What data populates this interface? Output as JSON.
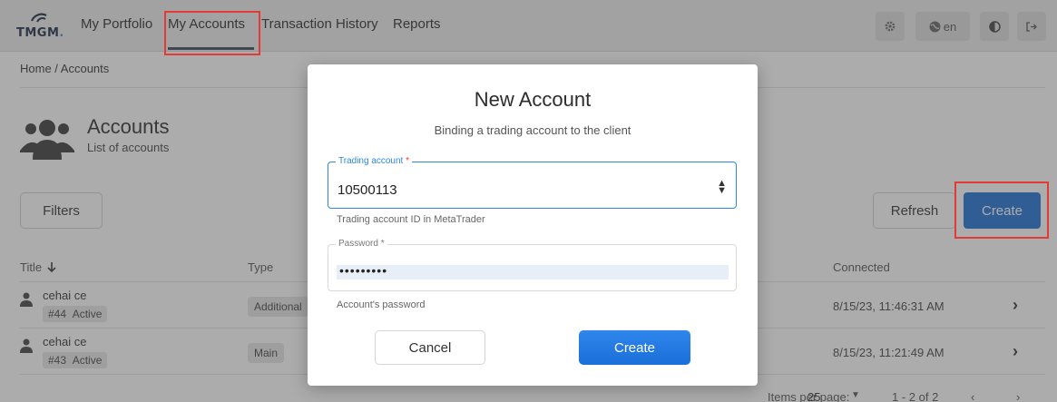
{
  "header": {
    "logo_text": "TMGM",
    "logo_dot": ".",
    "nav": [
      "My Portfolio",
      "My Accounts",
      "Transaction History",
      "Reports"
    ],
    "active_nav": "My Accounts",
    "tools": {
      "settings_icon": "gear-icon",
      "language": "en",
      "theme_icon": "contrast-icon",
      "logout_icon": "logout-icon"
    }
  },
  "breadcrumb": "Home / Accounts",
  "page": {
    "title": "Accounts",
    "subtitle": "List of accounts"
  },
  "actions": {
    "filters": "Filters",
    "refresh": "Refresh",
    "create": "Create"
  },
  "table": {
    "columns": {
      "title": "Title",
      "title_sort_icon": "arrow-down-icon",
      "type": "Type",
      "connected": "Connected"
    },
    "rows": [
      {
        "name": "cehai ce",
        "id": "#44",
        "status": "Active",
        "type": "Additional",
        "connected": "8/15/23, 11:46:31 AM"
      },
      {
        "name": "cehai ce",
        "id": "#43",
        "status": "Active",
        "type": "Main",
        "connected": "8/15/23, 11:21:49 AM"
      }
    ]
  },
  "pagination": {
    "items_per_page_label": "Items per page:",
    "items_per_page": "25",
    "range": "1 - 2 of 2"
  },
  "modal": {
    "title": "New Account",
    "subtitle": "Binding a trading account to the client",
    "trading_account": {
      "label": "Trading account",
      "required_mark": "*",
      "value": "10500113",
      "hint": "Trading account ID in MetaTrader"
    },
    "password": {
      "label": "Password",
      "required_mark": "*",
      "value": "•••••••••",
      "hint": "Account's password"
    },
    "cancel": "Cancel",
    "create": "Create"
  },
  "colors": {
    "primary": "#1f6fd6",
    "highlight": "#e53935",
    "focus": "#2e8ad9"
  }
}
